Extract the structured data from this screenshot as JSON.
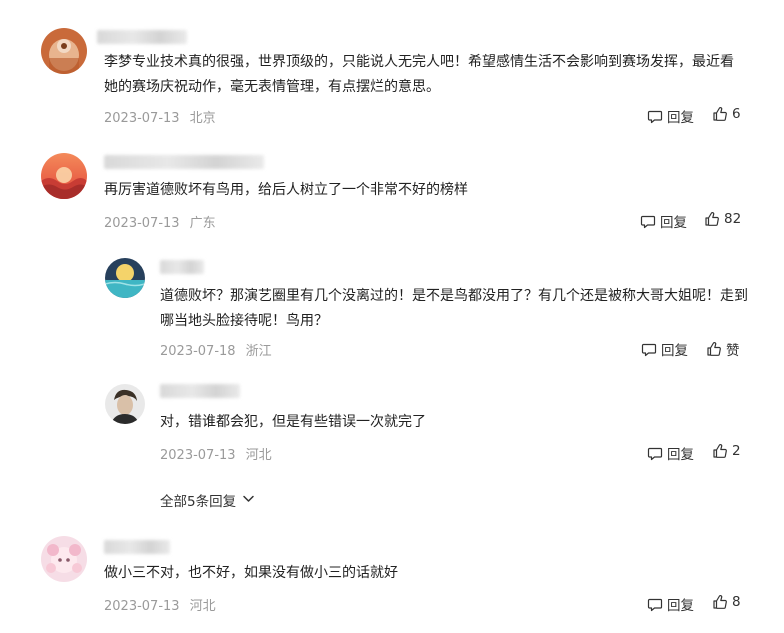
{
  "comments": [
    {
      "username": "",
      "text": "李梦专业技术真的很强，世界顶级的，只能说人无完人吧！希望感情生活不会影响到赛场发挥，最近看她的赛场庆祝动作，毫无表情管理，有点摆烂的意思。",
      "date": "2023-07-13",
      "location": "北京",
      "reply_label": "回复",
      "likes": "6"
    },
    {
      "username": "",
      "text": "再厉害道德败坏有鸟用，给后人树立了一个非常不好的榜样",
      "date": "2023-07-13",
      "location": "广东",
      "reply_label": "回复",
      "likes": "82",
      "replies": [
        {
          "username": "",
          "text": "道德败坏？那演艺圈里有几个没离过的！是不是鸟都没用了？有几个还是被称大哥大姐呢！走到哪当地头脸接待呢！鸟用？",
          "date": "2023-07-18",
          "location": "浙江",
          "reply_label": "回复",
          "likes": "赞"
        },
        {
          "username": "",
          "text": "对，错谁都会犯，但是有些错误一次就完了",
          "date": "2023-07-13",
          "location": "河北",
          "reply_label": "回复",
          "likes": "2"
        }
      ],
      "more_replies": "全部5条回复"
    },
    {
      "username": "",
      "text": "做小三不对，也不好，如果没有做小三的话就好",
      "date": "2023-07-13",
      "location": "河北",
      "reply_label": "回复",
      "likes": "8"
    }
  ],
  "icons": {
    "reply": "comment-bubble-icon",
    "like": "thumbs-up-icon",
    "expand": "chevron-down-icon"
  }
}
